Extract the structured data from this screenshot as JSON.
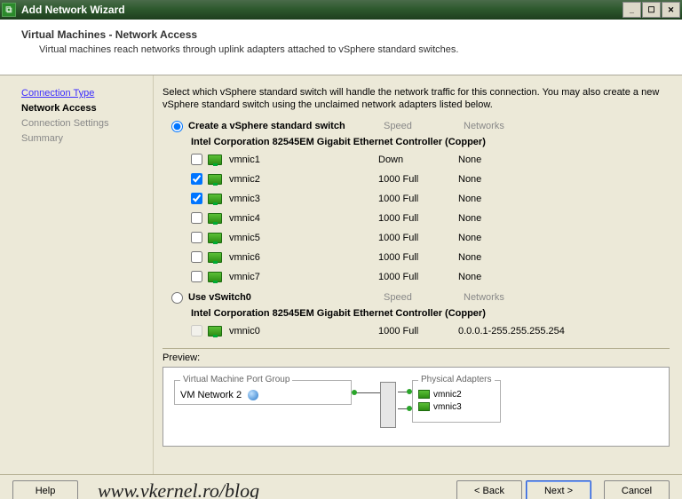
{
  "window": {
    "title": "Add Network Wizard",
    "min_label": "_",
    "max_label": "☐",
    "close_label": "✕"
  },
  "header": {
    "heading": "Virtual Machines - Network Access",
    "sub": "Virtual machines reach networks through uplink adapters attached to vSphere standard switches."
  },
  "nav": {
    "connection_type": "Connection Type",
    "network_access": "Network Access",
    "connection_settings": "Connection Settings",
    "summary": "Summary"
  },
  "content": {
    "instruction": "Select which vSphere standard switch will handle the network traffic for this connection. You may also create a new vSphere standard switch using the unclaimed network adapters listed below.",
    "col_speed": "Speed",
    "col_networks": "Networks",
    "option_create": {
      "label": "Create a vSphere standard switch",
      "group_label": "Intel Corporation 82545EM Gigabit Ethernet Controller (Copper)",
      "nics": [
        {
          "checked": false,
          "name": "vmnic1",
          "speed": "Down",
          "net": "None"
        },
        {
          "checked": true,
          "name": "vmnic2",
          "speed": "1000 Full",
          "net": "None"
        },
        {
          "checked": true,
          "name": "vmnic3",
          "speed": "1000 Full",
          "net": "None"
        },
        {
          "checked": false,
          "name": "vmnic4",
          "speed": "1000 Full",
          "net": "None"
        },
        {
          "checked": false,
          "name": "vmnic5",
          "speed": "1000 Full",
          "net": "None"
        },
        {
          "checked": false,
          "name": "vmnic6",
          "speed": "1000 Full",
          "net": "None"
        },
        {
          "checked": false,
          "name": "vmnic7",
          "speed": "1000 Full",
          "net": "None"
        }
      ]
    },
    "option_use": {
      "label": "Use vSwitch0",
      "group_label": "Intel Corporation 82545EM Gigabit Ethernet Controller (Copper)",
      "nics": [
        {
          "checked": false,
          "name": "vmnic0",
          "speed": "1000 Full",
          "net": "0.0.0.1-255.255.255.254"
        }
      ]
    },
    "preview": {
      "label": "Preview:",
      "pg_legend": "Virtual Machine Port Group",
      "pg_name": "VM Network 2",
      "pa_legend": "Physical Adapters",
      "pa_list": [
        "vmnic2",
        "vmnic3"
      ]
    }
  },
  "footer": {
    "help": "Help",
    "back": "< Back",
    "next": "Next >",
    "cancel": "Cancel",
    "watermark": "www.vkernel.ro/blog"
  }
}
